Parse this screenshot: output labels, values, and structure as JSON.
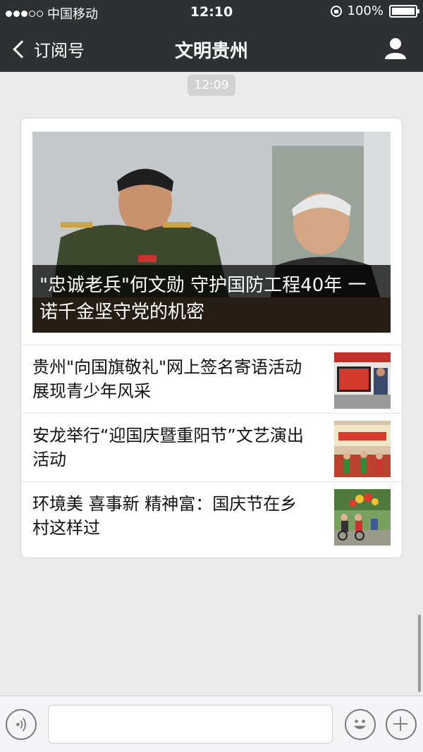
{
  "status_bar": {
    "carrier": "中国移动",
    "time": "12:10",
    "battery": "100%",
    "signal_dots_filled": 3,
    "signal_dots_total": 5
  },
  "nav": {
    "back_label": "订阅号",
    "title": "文明贵州"
  },
  "timestamp": "12:09",
  "article": {
    "headline": "\"忠诚老兵\"何文勋 守护国防工程40年 一诺千金坚守党的机密",
    "items": [
      {
        "title": "贵州\"向国旗敬礼\"网上签名寄语活动 展现青少年风采"
      },
      {
        "title": "安龙举行“迎国庆暨重阳节”文艺演出活动"
      },
      {
        "title": "环境美 喜事新 精神富：国庆节在乡村这样过"
      }
    ]
  },
  "input_bar": {
    "field_value": ""
  },
  "colors": {
    "nav_bg": "#2e3034",
    "page_bg": "#ebebeb"
  }
}
